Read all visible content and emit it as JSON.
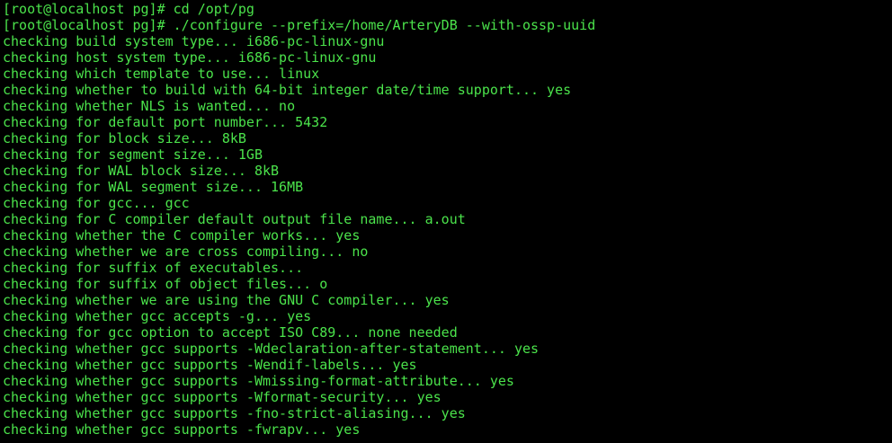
{
  "terminal": {
    "text_color": "#4be34b",
    "background_color": "#000000",
    "lines": [
      "[root@localhost pg]# cd /opt/pg",
      "[root@localhost pg]# ./configure --prefix=/home/ArteryDB --with-ossp-uuid",
      "checking build system type... i686-pc-linux-gnu",
      "checking host system type... i686-pc-linux-gnu",
      "checking which template to use... linux",
      "checking whether to build with 64-bit integer date/time support... yes",
      "checking whether NLS is wanted... no",
      "checking for default port number... 5432",
      "checking for block size... 8kB",
      "checking for segment size... 1GB",
      "checking for WAL block size... 8kB",
      "checking for WAL segment size... 16MB",
      "checking for gcc... gcc",
      "checking for C compiler default output file name... a.out",
      "checking whether the C compiler works... yes",
      "checking whether we are cross compiling... no",
      "checking for suffix of executables...",
      "checking for suffix of object files... o",
      "checking whether we are using the GNU C compiler... yes",
      "checking whether gcc accepts -g... yes",
      "checking for gcc option to accept ISO C89... none needed",
      "checking whether gcc supports -Wdeclaration-after-statement... yes",
      "checking whether gcc supports -Wendif-labels... yes",
      "checking whether gcc supports -Wmissing-format-attribute... yes",
      "checking whether gcc supports -Wformat-security... yes",
      "checking whether gcc supports -fno-strict-aliasing... yes",
      "checking whether gcc supports -fwrapv... yes"
    ]
  }
}
